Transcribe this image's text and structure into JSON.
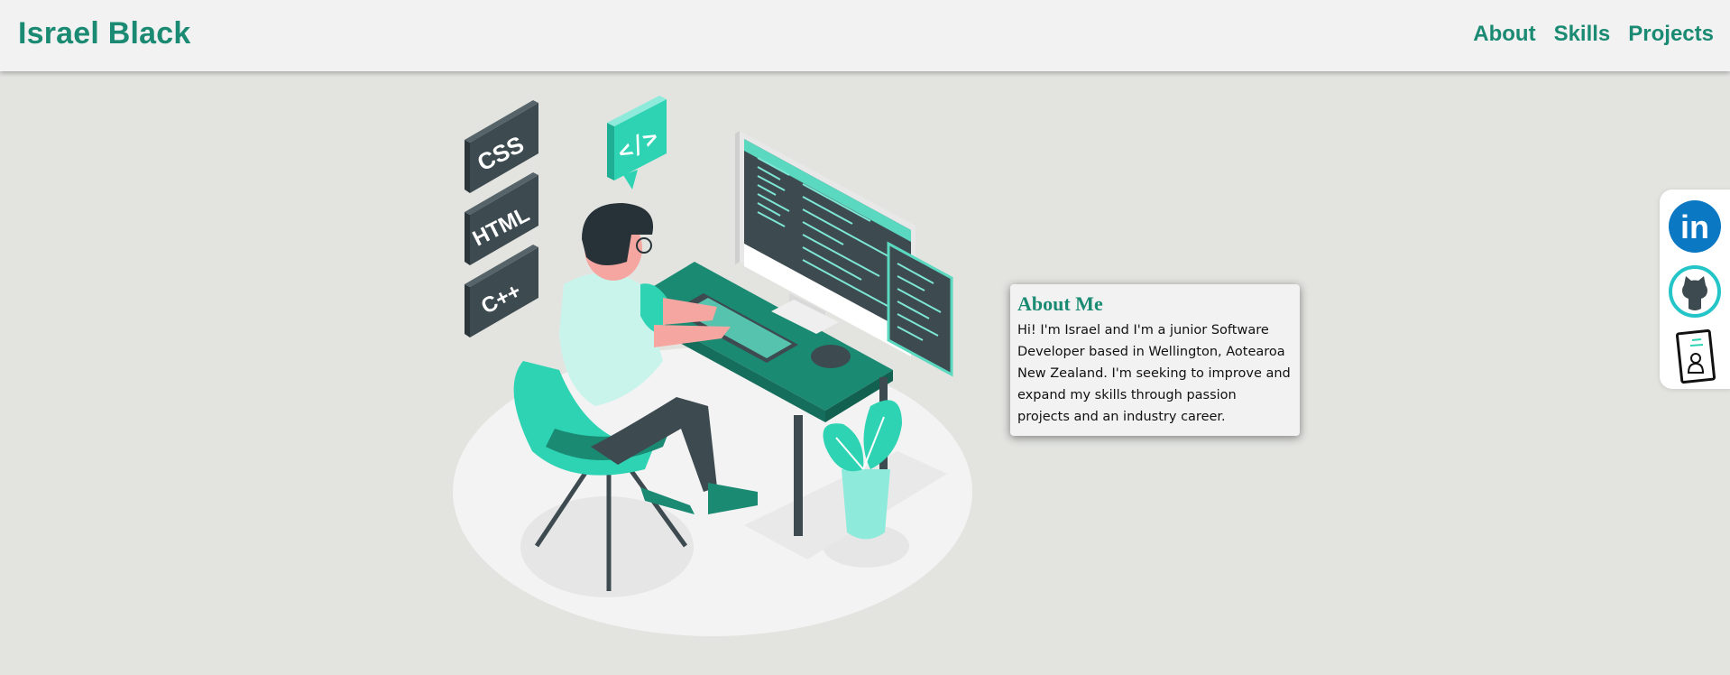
{
  "header": {
    "brand": "Israel Black",
    "nav": [
      {
        "label": "About"
      },
      {
        "label": "Skills"
      },
      {
        "label": "Projects"
      }
    ]
  },
  "hero": {
    "tech_blocks": [
      "CSS",
      "HTML",
      "C++"
    ],
    "code_bubble": "</>"
  },
  "about": {
    "title": "About Me",
    "body": "Hi! I'm Israel and I'm a junior Software Developer based in Wellington, Aotearoa New Zealand. I'm seeking to improve and expand my skills through passion projects and an industry career."
  },
  "social": {
    "linkedin_label": "in",
    "icons": [
      "linkedin-icon",
      "github-icon",
      "resume-icon"
    ]
  },
  "colors": {
    "brand": "#1a8a73",
    "background": "#e3e4e0",
    "header": "#f2f2f2",
    "linkedin": "#0a78c2",
    "github_ring": "#24c5c8"
  }
}
